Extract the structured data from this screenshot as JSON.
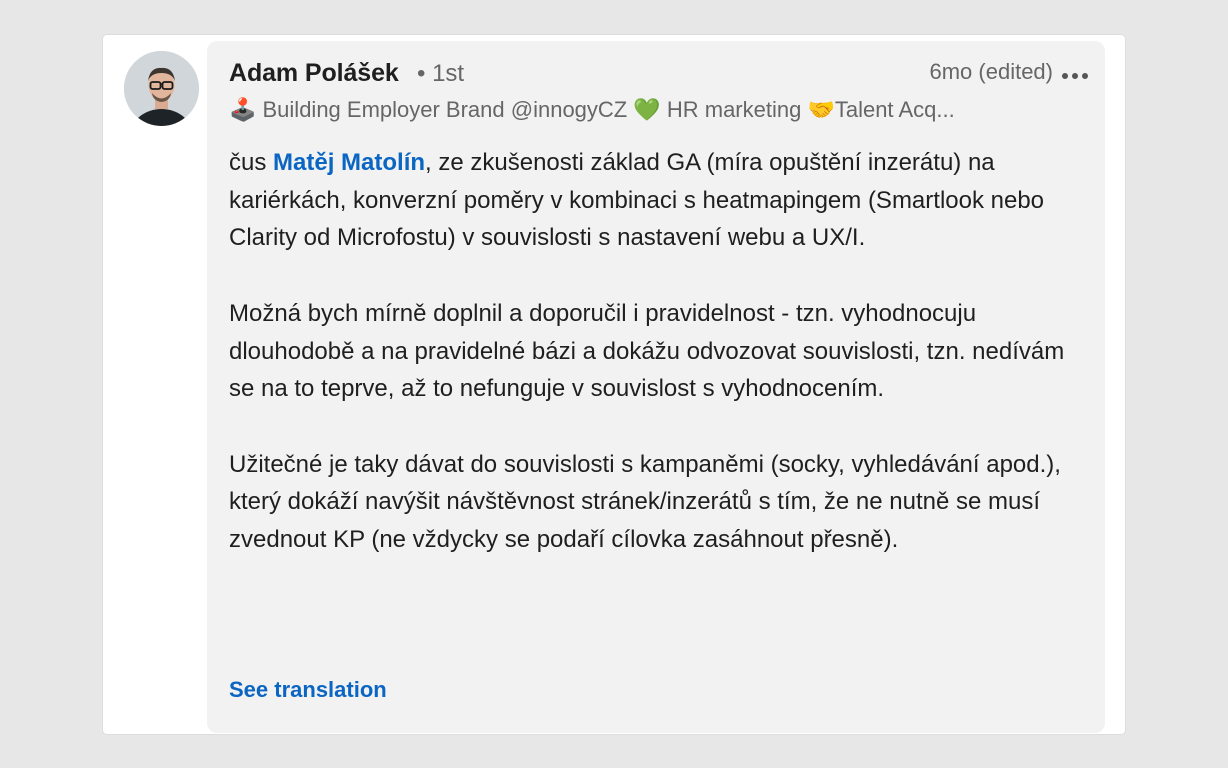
{
  "comment": {
    "author_name": "Adam Polášek",
    "degree": "• 1st",
    "time": "6mo (edited)",
    "headline": "🕹️ Building Employer Brand @innogyCZ 💚 HR marketing 🤝Talent Acq...",
    "mention": "Matěj Matolín",
    "para1_before": "čus ",
    "para1_after": ", ze zkušenosti základ GA (míra opuštění inzerátu) na kariérkách, konverzní poměry v kombinaci s heatmapingem (Smartlook nebo Clarity od Microfostu) v souvislosti s nastavení webu a UX/I.",
    "para2": "Možná bych mírně doplnil a doporučil i pravidelnost - tzn. vyhodnocuju dlouhodobě a na pravidelné bázi a dokážu odvozovat souvislosti, tzn. nedívám se na to teprve, až to nefunguje v souvislost s vyhodnocením.",
    "para3": "Užitečné je taky dávat do souvislosti s kampaněmi (socky, vyhledávání apod.), který dokáží navýšit návštěvnost stránek/inzerátů s tím, že ne nutně se musí zvednout KP (ne vždycky se podaří cílovka zasáhnout přesně).",
    "see_translation": "See translation"
  },
  "colors": {
    "link": "#0a66c2",
    "bubble": "#f2f2f2",
    "text": "#1f1f1f",
    "muted": "#666666"
  },
  "icons": {
    "more": "more-horizontal-icon"
  }
}
